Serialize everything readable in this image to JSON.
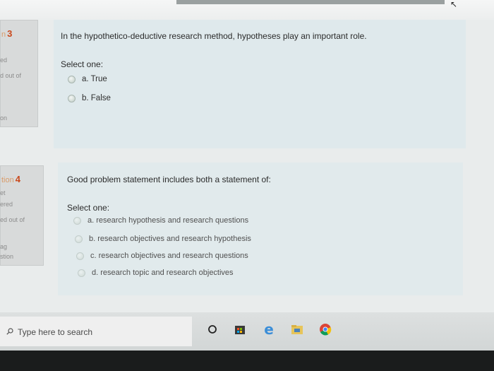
{
  "questions": [
    {
      "number_prefix": "n",
      "number": "3",
      "meta": [
        "ed",
        "d out of",
        "on"
      ],
      "text": "In the hypothetico-deductive research method, hypotheses play an important role.",
      "select_label": "Select one:",
      "options": [
        "a. True",
        "b. False"
      ]
    },
    {
      "number_prefix": "tion",
      "number": "4",
      "meta": [
        "et",
        "ered",
        "ed out of",
        "ag",
        "stion"
      ],
      "text": "Good problem statement includes both a statement of:",
      "select_label": "Select one:",
      "options": [
        "a. research hypothesis and research questions",
        "b. research objectives and research hypothesis",
        "c. research objectives and research questions",
        "d. research topic and research objectives"
      ]
    }
  ],
  "taskbar": {
    "search_placeholder": "Type here to search",
    "apps": [
      "task-view-icon",
      "store-icon",
      "edge-icon",
      "file-explorer-icon",
      "chrome-icon"
    ]
  },
  "colors": {
    "question_number": "#c9491d",
    "question_panel": "#dfe9ec",
    "info_panel": "#d8dada"
  }
}
